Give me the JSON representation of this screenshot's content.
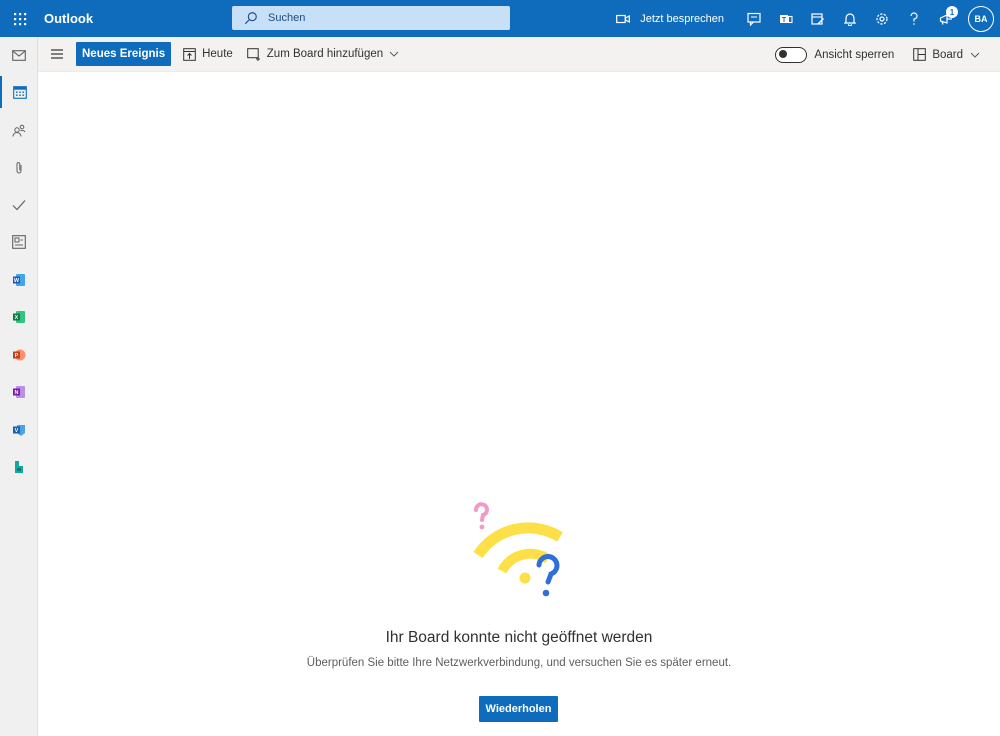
{
  "app": {
    "title": "Outlook"
  },
  "search": {
    "placeholder": "Suchen"
  },
  "topbar": {
    "meet_now_label": "Jetzt besprechen",
    "notification_badge": "1",
    "avatar_initials": "BA"
  },
  "rail": {
    "items": [
      "mail-icon",
      "calendar-icon",
      "people-icon",
      "attachment-icon",
      "todo-icon",
      "board-icon",
      "word-icon",
      "excel-icon",
      "powerpoint-icon",
      "onenote-icon",
      "viva-icon",
      "bookings-icon"
    ]
  },
  "commandbar": {
    "new_event_label": "Neues Ereignis",
    "today_label": "Heute",
    "add_to_board_label": "Zum Board hinzufügen",
    "lock_view_label": "Ansicht sperren",
    "board_label": "Board"
  },
  "error": {
    "title": "Ihr Board konnte nicht geöffnet werden",
    "message": "Überprüfen Sie bitte Ihre Netzwerkverbindung, und versuchen Sie es später erneut.",
    "retry_label": "Wiederholen"
  },
  "colors": {
    "brand": "#0f6cbd",
    "wifi_yellow": "#fde047",
    "question_pink": "#f29ac6",
    "question_blue": "#2f6fd8"
  }
}
